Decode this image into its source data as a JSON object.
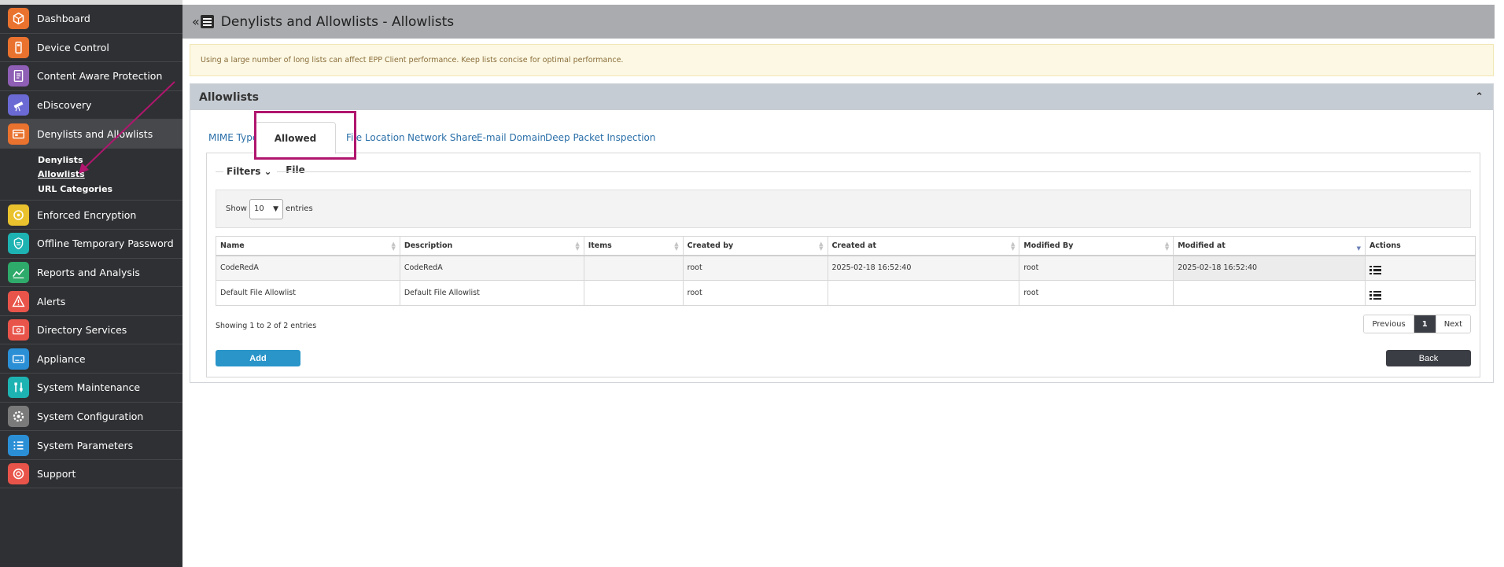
{
  "sidebar": {
    "items": [
      {
        "label": "Dashboard",
        "icon": "dashboard-icon",
        "color": "#e9722e"
      },
      {
        "label": "Device Control",
        "icon": "device-control-icon",
        "color": "#e9722e"
      },
      {
        "label": "Content Aware Protection",
        "icon": "content-aware-icon",
        "color": "#8e5fb5"
      },
      {
        "label": "eDiscovery",
        "icon": "telescope-icon",
        "color": "#6b6ad4"
      },
      {
        "label": "Denylists and Allowlists",
        "icon": "lists-icon",
        "color": "#e9722e"
      },
      {
        "label": "Enforced Encryption",
        "icon": "encryption-icon",
        "color": "#e9c22e"
      },
      {
        "label": "Offline Temporary Password",
        "icon": "password-icon",
        "color": "#1eb3b3"
      },
      {
        "label": "Reports and Analysis",
        "icon": "reports-icon",
        "color": "#2eaa6a"
      },
      {
        "label": "Alerts",
        "icon": "alert-icon",
        "color": "#e9544a"
      },
      {
        "label": "Directory Services",
        "icon": "directory-icon",
        "color": "#e9544a"
      },
      {
        "label": "Appliance",
        "icon": "appliance-icon",
        "color": "#2b8fd6"
      },
      {
        "label": "System Maintenance",
        "icon": "tools-icon",
        "color": "#1eb3b3"
      },
      {
        "label": "System Configuration",
        "icon": "gear-icon",
        "color": "#7a7a7a"
      },
      {
        "label": "System Parameters",
        "icon": "parameters-icon",
        "color": "#2b8fd6"
      },
      {
        "label": "Support",
        "icon": "support-icon",
        "color": "#e9544a"
      }
    ],
    "submenu": [
      "Denylists",
      "Allowlists",
      "URL Categories"
    ]
  },
  "header": {
    "collapse": "«",
    "title": "Denylists and Allowlists - Allowlists"
  },
  "warning": "Using a large number of long lists can affect EPP Client performance. Keep lists concise for optimal performance.",
  "panel": {
    "title": "Allowlists",
    "tabs": [
      "MIME Type",
      "Allowed File",
      "File Location",
      "Network Share",
      "E-mail Domain",
      "Deep Packet Inspection"
    ],
    "filters_label": "Filters",
    "length": {
      "show": "Show",
      "value": "10",
      "entries": "entries"
    },
    "columns": [
      "Name",
      "Description",
      "Items",
      "Created by",
      "Created at",
      "Modified By",
      "Modified at",
      "Actions"
    ],
    "rows": [
      {
        "name": "CodeRedA",
        "description": "CodeRedA",
        "items": "",
        "created_by": "root",
        "created_at": "2025-02-18 16:52:40",
        "modified_by": "root",
        "modified_at": "2025-02-18 16:52:40"
      },
      {
        "name": "Default File Allowlist",
        "description": "Default File Allowlist",
        "items": "",
        "created_by": "root",
        "created_at": "",
        "modified_by": "root",
        "modified_at": ""
      }
    ],
    "info": "Showing 1 to 2 of 2 entries",
    "pager": {
      "previous": "Previous",
      "current": "1",
      "next": "Next"
    },
    "add_label": "Add",
    "back_label": "Back"
  },
  "colors": {
    "highlight": "#b0166e",
    "accent": "#2995c9"
  }
}
